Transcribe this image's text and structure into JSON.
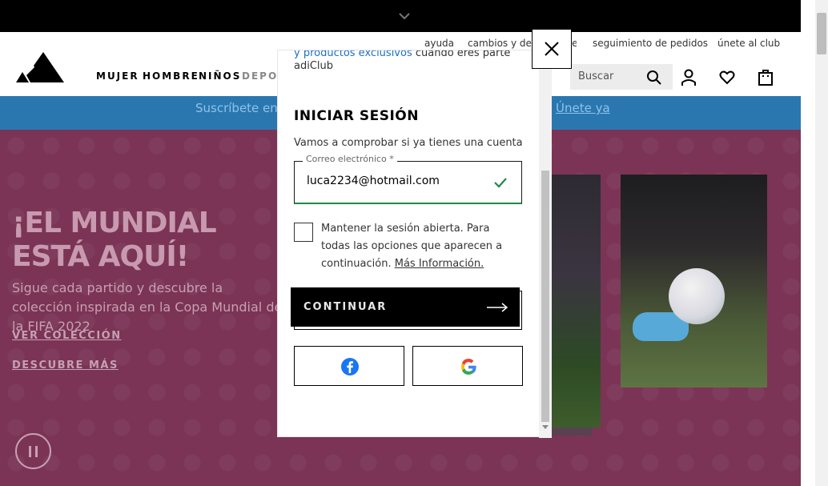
{
  "header": {
    "util_links": [
      "ayuda",
      "cambios y devoluciones",
      "seguimiento de pedidos",
      "únete al club"
    ],
    "nav": [
      "MUJER",
      "HOMBRE",
      "NIÑOS",
      "DEPORTES"
    ],
    "search_placeholder": "Buscar"
  },
  "promo": {
    "text": "Suscríbete en",
    "link": "Únete ya"
  },
  "hero": {
    "title": "¡EL MUNDIAL ESTÁ AQUÍ!",
    "subtitle": "Sigue cada partido y descubre la colección inspirada en la Copa Mundial de la FIFA 2022",
    "link1": "VER COLECCIÓN",
    "link2": "DESCUBRE MÁS"
  },
  "modal": {
    "top_blue": "y productos exclusivos",
    "top_rest": " cuando eres parte",
    "club": "adiClub",
    "title": "INICIAR SESIÓN",
    "description": "Vamos a comprobar si ya tienes una cuenta",
    "email_label": "Correo electrónico *",
    "email_value": "luca2234@hotmail.com",
    "keep_session_text": "Mantener la sesión abierta. Para todas las opciones que aparecen a continuación.",
    "more_info": "Más Información.",
    "continue_label": "CONTINUAR"
  },
  "colors": {
    "accent_success": "#1d8b45",
    "facebook": "#1877f2",
    "promo_bg": "#2a77b0",
    "hero_bg": "#7b3455"
  },
  "icons": [
    "chevron-down-icon",
    "adidas-logo",
    "search-icon",
    "user-icon",
    "heart-icon",
    "bag-icon",
    "close-icon",
    "check-icon",
    "arrow-right-icon",
    "facebook-icon",
    "google-icon",
    "pause-icon"
  ]
}
